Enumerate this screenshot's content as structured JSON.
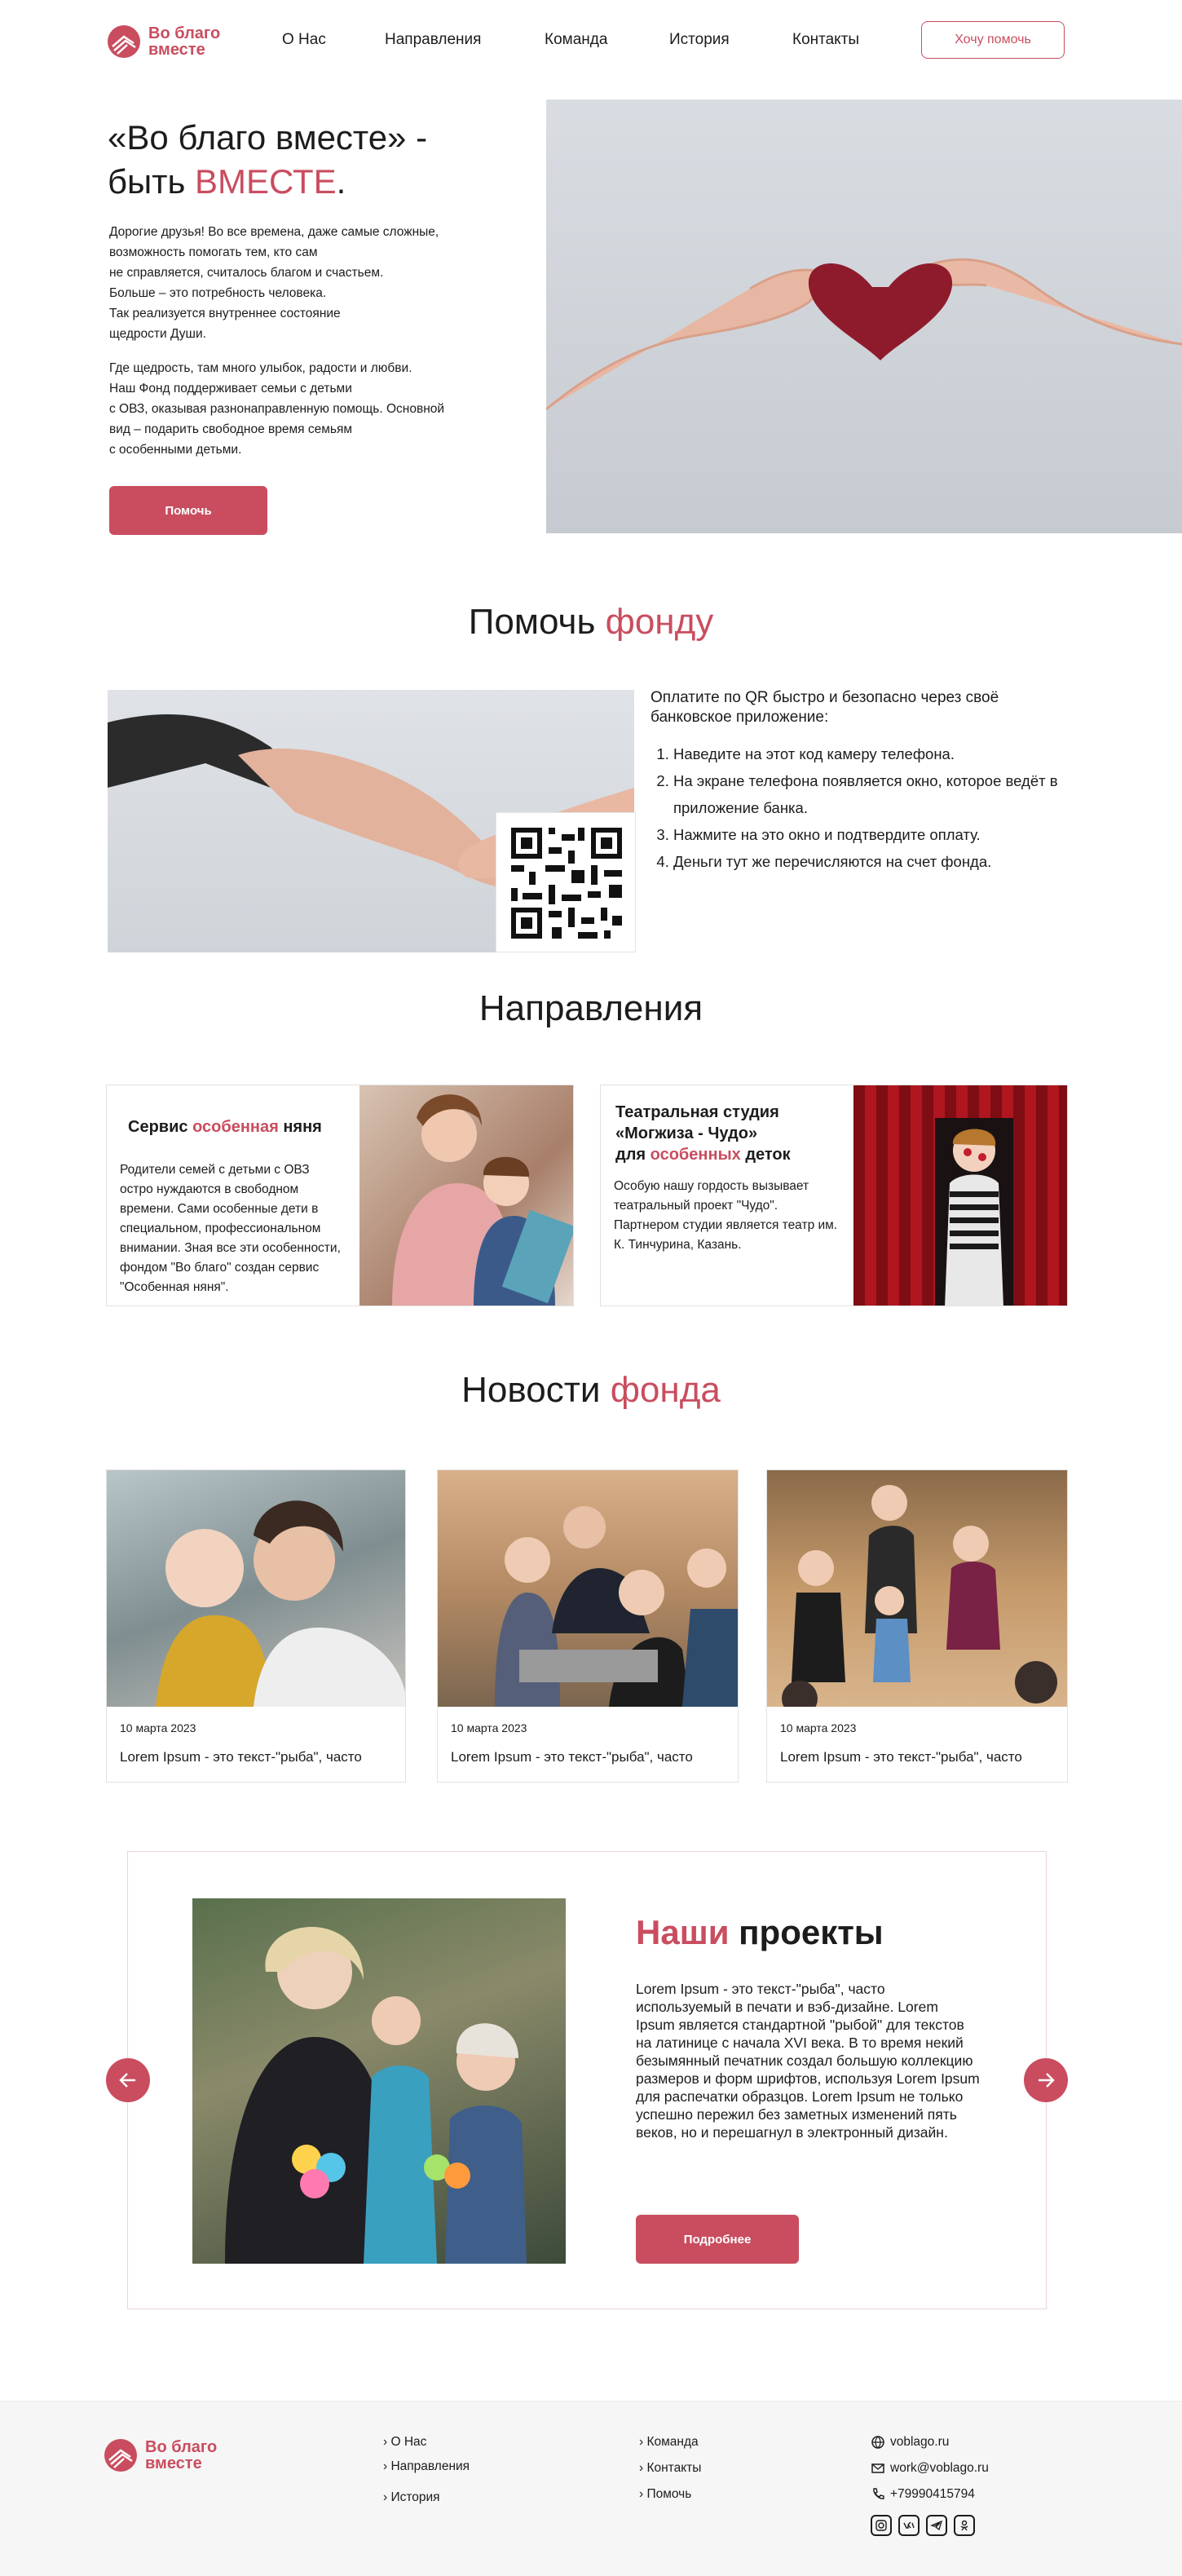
{
  "header": {
    "logo_text_1": "Во благо",
    "logo_text_2": "вместе",
    "nav": [
      "О Нас",
      "Направления",
      "Команда",
      "История",
      "Контакты"
    ],
    "help_button": "Хочу помочь"
  },
  "hero": {
    "title_1": "«Во благо вместе» -",
    "title_2a": "быть ",
    "title_2b": "ВМЕСТЕ",
    "title_2c": ".",
    "para_1": "Дорогие друзья! Во все времена, даже самые сложные,\nвозможность помогать тем, кто сам\nне справляется, считалось благом и счастьем.\nБольше – это потребность человека.\nТак реализуется внутреннее состояние\nщедрости Души.",
    "para_2": "Где щедрость, там много улыбок, радости и любви.\nНаш Фонд поддерживает семьи с детьми\nс ОВЗ, оказывая  разнонаправленную помощь. Основной\nвид – подарить свободное время семьям\nс особенными детьми.",
    "button": "Помочь"
  },
  "donate": {
    "title_a": "Помочь ",
    "title_b": "фонду",
    "intro": "Оплатите по QR быстро и безопасно через своё банковское приложение:",
    "steps": [
      "Наведите на этот код камеру телефона.",
      "На экране телефона появляется окно, которое ведёт в приложение банка.",
      "Нажмите на это окно и подтвердите оплату.",
      "Деньги тут же перечисляются на счет фонда."
    ]
  },
  "directions": {
    "title": "Направления",
    "card1": {
      "title_a": "Сервис ",
      "title_b": "особенная",
      "title_c": " няня",
      "text": "Родители семей с детьми с ОВЗ остро нуждаются в свободном времени. Сами особенные дети в специальном, профессиональном внимании. Зная все эти особенности, фондом \"Во благо\" создан сервис \"Особенная няня\"."
    },
    "card2": {
      "title_a": "Театральная студия «Могжиза - Чудо»",
      "title_b": "для ",
      "title_c": "особенных",
      "title_d": " деток",
      "text": "Особую нашу гордость вызывает театральный проект \"Чудо\". Партнером студии является театр им. К. Тинчурина, Казань."
    }
  },
  "news": {
    "title_a": "Новости ",
    "title_b": "фонда",
    "items": [
      {
        "date": "10 марта 2023",
        "title": "Lorem Ipsum - это текст-\"рыба\", часто"
      },
      {
        "date": "10 марта 2023",
        "title": "Lorem Ipsum - это текст-\"рыба\", часто"
      },
      {
        "date": "10 марта 2023",
        "title": "Lorem Ipsum - это текст-\"рыба\", часто"
      }
    ]
  },
  "projects": {
    "title_a": "Наши",
    "title_b": " проекты",
    "text": "Lorem Ipsum - это текст-\"рыба\", часто используемый в печати и вэб-дизайне. Lorem Ipsum является стандартной \"рыбой\" для текстов на латинице с начала XVI века. В то время некий безымянный печатник создал большую коллекцию размеров и форм шрифтов, используя Lorem Ipsum для распечатки образцов. Lorem Ipsum не только успешно пережил без заметных изменений пять веков, но и перешагнул в электронный дизайн.",
    "button": "Подробнее"
  },
  "footer": {
    "col1": [
      "О Нас",
      "Направления",
      "История"
    ],
    "col2": [
      "Команда",
      "Контакты",
      "Помочь"
    ],
    "site": "voblago.ru",
    "email": "work@voblago.ru",
    "phone": "+79990415794"
  },
  "colors": {
    "accent": "#c94d5f",
    "text": "#1c1c1c",
    "border": "#e2e2e2"
  }
}
